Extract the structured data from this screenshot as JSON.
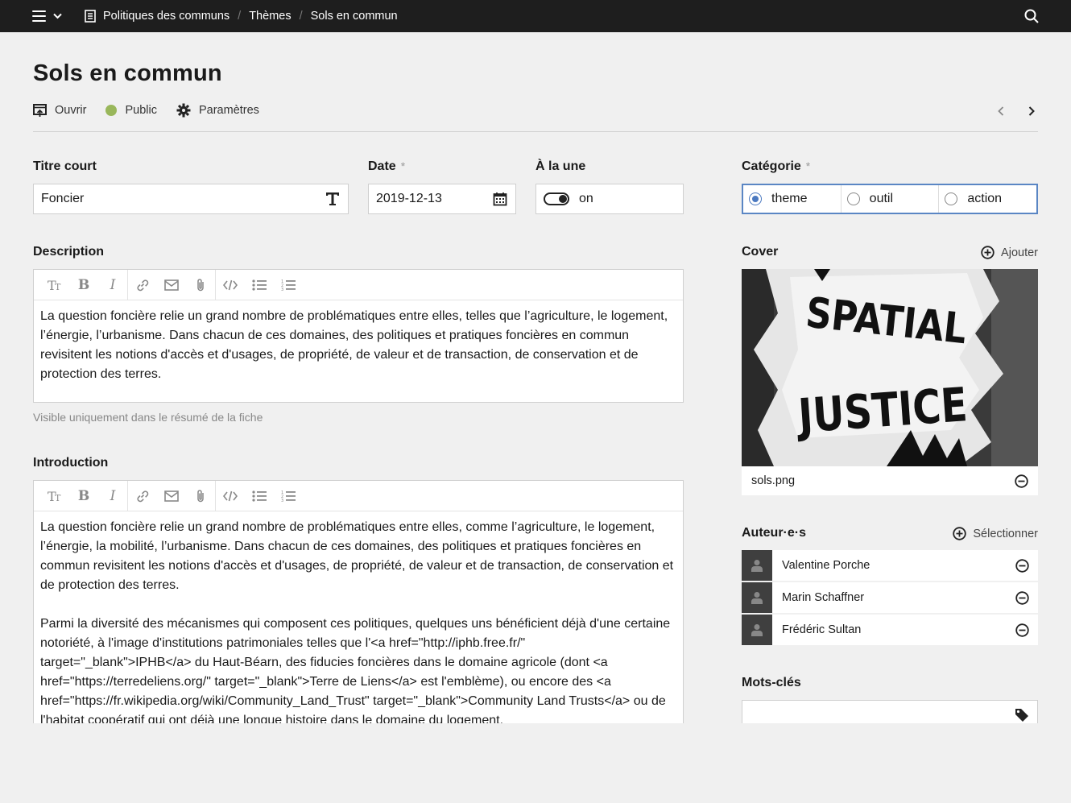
{
  "topbar": {
    "breadcrumbs": [
      "Politiques des communs",
      "Thèmes",
      "Sols en commun"
    ]
  },
  "header": {
    "title": "Sols en commun",
    "actions": {
      "open": "Ouvrir",
      "status": "Public",
      "settings": "Paramètres"
    },
    "status_color": "#99b75b"
  },
  "fields": {
    "short_title": {
      "label": "Titre court",
      "value": "Foncier"
    },
    "date": {
      "label": "Date",
      "required": "*",
      "value": "2019-12-13"
    },
    "featured": {
      "label": "À la une",
      "value": "on"
    },
    "category": {
      "label": "Catégorie",
      "required": "*",
      "options": [
        "theme",
        "outil",
        "action"
      ],
      "selected": "theme"
    }
  },
  "description": {
    "label": "Description",
    "text": "La question foncière relie un grand nombre de problématiques entre elles, telles que l’agriculture, le logement, l’énergie, l’urbanisme. Dans chacun de ces domaines, des politiques et pratiques foncières en commun revisitent les notions d'accès et d'usages, de propriété, de valeur et de transaction, de conservation et de protection des terres.",
    "help": "Visible uniquement dans le résumé de la fiche"
  },
  "introduction": {
    "label": "Introduction",
    "paragraphs": [
      "La question foncière relie un grand nombre de problématiques entre elles, comme l’agriculture, le logement, l’énergie, la mobilité, l’urbanisme. Dans chacun de ces domaines, des politiques et pratiques foncières en commun revisitent les notions d'accès et d'usages, de propriété, de valeur et de transaction, de conservation et de protection des terres.",
      "Parmi la diversité des mécanismes qui composent ces politiques, quelques uns bénéficient déjà d'une certaine notoriété, à l'image d'institutions patrimoniales telles que l'<a href=\"http://iphb.free.fr/\" target=\"_blank\">IPHB</a> du Haut-Béarn, des fiducies foncières dans le domaine agricole (dont <a href=\"https://terredeliens.org/\" target=\"_blank\">Terre de Liens</a> est l'emblème), ou encore des <a href=\"https://fr.wikipedia.org/wiki/Community_Land_Trust\" target=\"_blank\">Community Land Trusts</a> ou de l'habitat coopératif qui ont déjà une longue histoire dans le domaine du logement."
    ]
  },
  "cover": {
    "label": "Cover",
    "add": "Ajouter",
    "filename": "sols.png",
    "image_text": [
      "SPATIAL",
      "JUSTICE"
    ]
  },
  "authors": {
    "label": "Auteur·e·s",
    "select": "Sélectionner",
    "list": [
      "Valentine Porche",
      "Marin Schaffner",
      "Frédéric Sultan"
    ]
  },
  "keywords": {
    "label": "Mots-clés"
  },
  "colors": {
    "topbar": "#1e1e1e",
    "accent": "#4b79c0",
    "background": "#f0f0f0"
  }
}
